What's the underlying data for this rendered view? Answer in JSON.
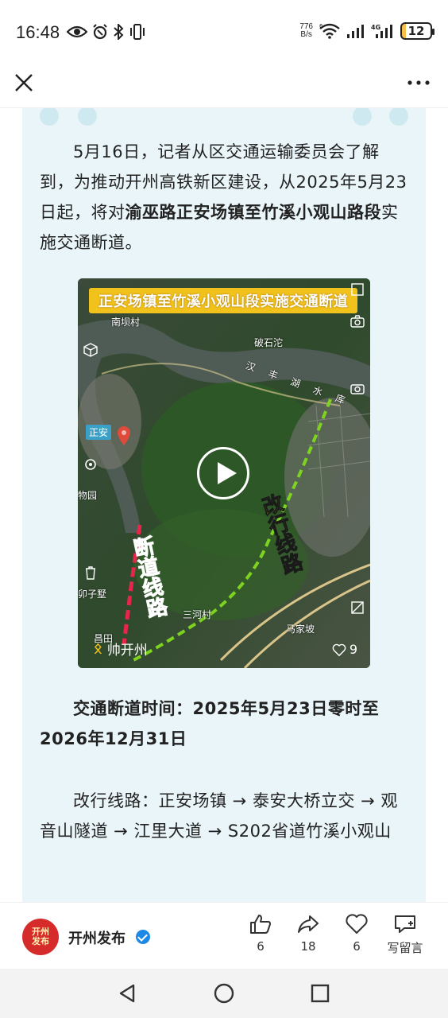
{
  "status_bar": {
    "time": "16:48",
    "net_speed_value": "776",
    "net_speed_unit": "B/s",
    "wifi_badge": "6",
    "signal_badge": "4G",
    "battery": "12",
    "icons": [
      "eye-icon",
      "alarm-icon",
      "bluetooth-icon",
      "vibrate-icon",
      "wifi-icon",
      "signal-icon",
      "battery-icon"
    ]
  },
  "app_bar": {
    "close_icon": "close-icon",
    "more_icon": "more-icon"
  },
  "article": {
    "p1_part1": "5月16日，记者从区交通运输委员会了解到，为推动开州高铁新区建设，从2025年5月23日起，将对",
    "p1_bold": "渝巫路正安场镇至竹溪小观山路段",
    "p1_part2": "实施交通断道。",
    "p2": "交通断道时间：2025年5月23日零时至2026年12月31日",
    "p3": "改行线路：正安场镇 → 泰安大桥立交 → 观音山隧道 → 江里大道 → S202省道竹溪小观山"
  },
  "video": {
    "title": "正安场镇至竹溪小观山段实施交通断道",
    "tag_zhengan": "正安",
    "label_red": "断道线路",
    "label_green": "改行线路",
    "map_labels": {
      "nanba": "南坝村",
      "poshi": "破石沱",
      "hanfeng": "汉丰湖水库",
      "wuyuan": "物园",
      "zijiang": "卯子墅",
      "sanhe": "三河村",
      "majia": "马家坡",
      "xichou": "昌田"
    },
    "watermark": "帅开州",
    "like_count": "9"
  },
  "action_bar": {
    "account_name": "开州发布",
    "avatar_text": "开州发布",
    "like_count": "6",
    "share_count": "18",
    "fav_count": "6",
    "comment_label": "写留言"
  },
  "colors": {
    "article_bg": "#e9f5f9",
    "title_yellow": "#f2c21c",
    "route_red": "#e6264a",
    "route_green": "#7ed321",
    "verified_blue": "#1e88e5"
  }
}
